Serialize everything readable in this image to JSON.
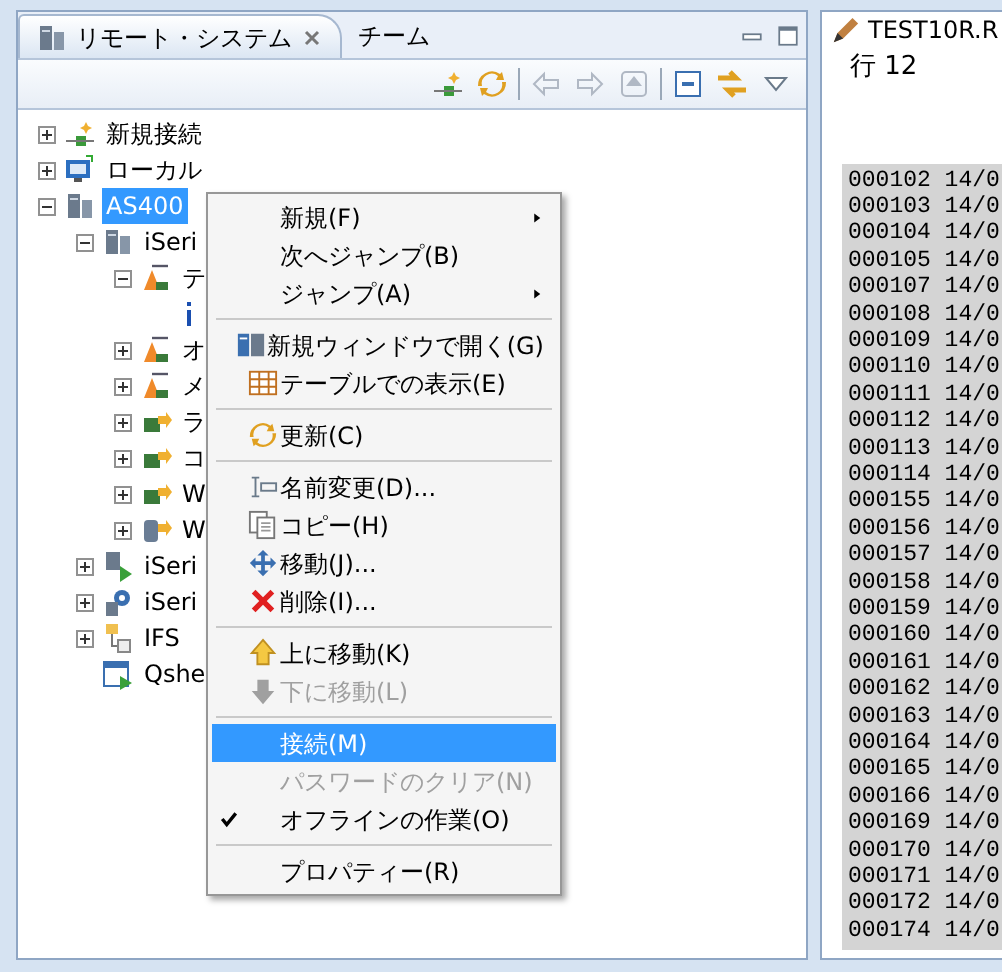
{
  "left_panel": {
    "tabs": [
      {
        "label": "リモート・システム",
        "selected": true,
        "closable": true
      },
      {
        "label": "チーム",
        "selected": false,
        "closable": false
      }
    ],
    "tree": [
      {
        "label": "新規接続",
        "expanded": false,
        "selected": false
      },
      {
        "label": "ローカル",
        "expanded": false,
        "selected": false
      },
      {
        "label": "AS400",
        "expanded": true,
        "selected": true,
        "children": [
          {
            "label": "iSeri",
            "expanded": true,
            "selected": false,
            "children": [
              {
                "label": "テ",
                "expanded": true,
                "selected": false,
                "children": [
                  {
                    "kind": "leaf"
                  }
                ]
              },
              {
                "label": "オ",
                "expanded": false,
                "selected": false
              },
              {
                "label": "メ",
                "expanded": false,
                "selected": false
              },
              {
                "label": "ラ",
                "expanded": false,
                "selected": false
              },
              {
                "label": "コ",
                "expanded": false,
                "selected": false
              },
              {
                "label": "W",
                "expanded": false,
                "selected": false
              },
              {
                "label": "W",
                "expanded": false,
                "selected": false
              }
            ]
          },
          {
            "label": "iSeri",
            "expanded": false,
            "selected": false
          },
          {
            "label": "iSeri",
            "expanded": false,
            "selected": false
          },
          {
            "label": "IFS",
            "expanded": false,
            "selected": false
          },
          {
            "label": "Qshe",
            "selected": false
          }
        ]
      }
    ]
  },
  "context_menu": [
    {
      "kind": "item",
      "label": "新規(F)",
      "submenu": true,
      "selected": false,
      "disabled": false,
      "checked": false
    },
    {
      "kind": "item",
      "label": "次へジャンプ(B)",
      "submenu": false,
      "selected": false,
      "disabled": false,
      "checked": false
    },
    {
      "kind": "item",
      "label": "ジャンプ(A)",
      "submenu": true,
      "selected": false,
      "disabled": false,
      "checked": false
    },
    {
      "kind": "separator"
    },
    {
      "kind": "item",
      "label": "新規ウィンドウで開く(G)",
      "submenu": false,
      "selected": false,
      "disabled": false,
      "checked": false
    },
    {
      "kind": "item",
      "label": "テーブルでの表示(E)",
      "submenu": false,
      "selected": false,
      "disabled": false,
      "checked": false
    },
    {
      "kind": "separator"
    },
    {
      "kind": "item",
      "label": "更新(C)",
      "submenu": false,
      "selected": false,
      "disabled": false,
      "checked": false
    },
    {
      "kind": "separator"
    },
    {
      "kind": "item",
      "label": "名前変更(D)...",
      "submenu": false,
      "selected": false,
      "disabled": false,
      "checked": false
    },
    {
      "kind": "item",
      "label": "コピー(H)",
      "submenu": false,
      "selected": false,
      "disabled": false,
      "checked": false
    },
    {
      "kind": "item",
      "label": "移動(J)...",
      "submenu": false,
      "selected": false,
      "disabled": false,
      "checked": false
    },
    {
      "kind": "item",
      "label": "削除(I)...",
      "submenu": false,
      "selected": false,
      "disabled": false,
      "checked": false
    },
    {
      "kind": "separator"
    },
    {
      "kind": "item",
      "label": "上に移動(K)",
      "submenu": false,
      "selected": false,
      "disabled": false,
      "checked": false
    },
    {
      "kind": "item",
      "label": "下に移動(L)",
      "submenu": false,
      "selected": false,
      "disabled": true,
      "checked": false
    },
    {
      "kind": "separator"
    },
    {
      "kind": "item",
      "label": "接続(M)",
      "submenu": false,
      "selected": true,
      "disabled": false,
      "checked": false
    },
    {
      "kind": "item",
      "label": "パスワードのクリア(N)",
      "submenu": false,
      "selected": false,
      "disabled": true,
      "checked": false
    },
    {
      "kind": "item",
      "label": "オフラインの作業(O)",
      "submenu": false,
      "selected": false,
      "disabled": false,
      "checked": true
    },
    {
      "kind": "separator"
    },
    {
      "kind": "item",
      "label": "プロパティー(R)",
      "submenu": false,
      "selected": false,
      "disabled": false,
      "checked": false
    }
  ],
  "editor": {
    "tab": {
      "label": "TEST10R.R"
    },
    "line_label": "行 12",
    "rows": [
      "000102 14/0",
      "000103 14/0",
      "000104 14/0",
      "000105 14/0",
      "000107 14/0",
      "000108 14/0",
      "000109 14/0",
      "000110 14/0",
      "000111 14/0",
      "000112 14/0",
      "000113 14/0",
      "000114 14/0",
      "000155 14/0",
      "000156 14/0",
      "000157 14/0",
      "000158 14/0",
      "000159 14/0",
      "000160 14/0",
      "000161 14/0",
      "000162 14/0",
      "000163 14/0",
      "000164 14/0",
      "000165 14/0",
      "000166 14/0",
      "000169 14/0",
      "000170 14/0",
      "000171 14/0",
      "000172 14/0",
      "000174 14/0"
    ]
  }
}
